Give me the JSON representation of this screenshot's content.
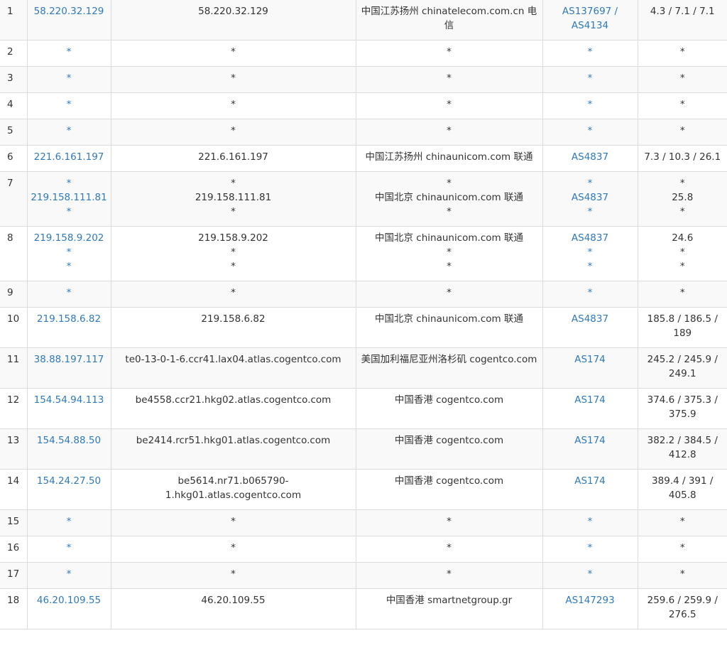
{
  "rows": [
    {
      "hop": "1",
      "ip": [
        "58.220.32.129"
      ],
      "host": [
        "58.220.32.129"
      ],
      "loc": [
        "中国江苏扬州 chinatelecom.com.cn 电信"
      ],
      "asn": [
        "AS137697 / AS4134"
      ],
      "time": [
        "4.3 / 7.1 / 7.1"
      ]
    },
    {
      "hop": "2",
      "ip": [
        "*"
      ],
      "host": [
        "*"
      ],
      "loc": [
        "*"
      ],
      "asn": [
        "*"
      ],
      "time": [
        "*"
      ]
    },
    {
      "hop": "3",
      "ip": [
        "*"
      ],
      "host": [
        "*"
      ],
      "loc": [
        "*"
      ],
      "asn": [
        "*"
      ],
      "time": [
        "*"
      ]
    },
    {
      "hop": "4",
      "ip": [
        "*"
      ],
      "host": [
        "*"
      ],
      "loc": [
        "*"
      ],
      "asn": [
        "*"
      ],
      "time": [
        "*"
      ]
    },
    {
      "hop": "5",
      "ip": [
        "*"
      ],
      "host": [
        "*"
      ],
      "loc": [
        "*"
      ],
      "asn": [
        "*"
      ],
      "time": [
        "*"
      ]
    },
    {
      "hop": "6",
      "ip": [
        "221.6.161.197"
      ],
      "host": [
        "221.6.161.197"
      ],
      "loc": [
        "中国江苏扬州 chinaunicom.com 联通"
      ],
      "asn": [
        "AS4837"
      ],
      "time": [
        "7.3 / 10.3 / 26.1"
      ]
    },
    {
      "hop": "7",
      "ip": [
        "*",
        "219.158.111.81",
        "*"
      ],
      "host": [
        "*",
        "219.158.111.81",
        "*"
      ],
      "loc": [
        "*",
        "中国北京 chinaunicom.com 联通",
        "*"
      ],
      "asn": [
        "*",
        "AS4837",
        "*"
      ],
      "time": [
        "*",
        "25.8",
        "*"
      ]
    },
    {
      "hop": "8",
      "ip": [
        "219.158.9.202",
        "*",
        "*"
      ],
      "host": [
        "219.158.9.202",
        "*",
        "*"
      ],
      "loc": [
        "中国北京 chinaunicom.com 联通",
        "*",
        "*"
      ],
      "asn": [
        "AS4837",
        "*",
        "*"
      ],
      "time": [
        "24.6",
        "*",
        "*"
      ]
    },
    {
      "hop": "9",
      "ip": [
        "*"
      ],
      "host": [
        "*"
      ],
      "loc": [
        "*"
      ],
      "asn": [
        "*"
      ],
      "time": [
        "*"
      ]
    },
    {
      "hop": "10",
      "ip": [
        "219.158.6.82"
      ],
      "host": [
        "219.158.6.82"
      ],
      "loc": [
        "中国北京 chinaunicom.com 联通"
      ],
      "asn": [
        "AS4837"
      ],
      "time": [
        "185.8 / 186.5 / 189"
      ]
    },
    {
      "hop": "11",
      "ip": [
        "38.88.197.117"
      ],
      "host": [
        "te0-13-0-1-6.ccr41.lax04.atlas.cogentco.com"
      ],
      "loc": [
        "美国加利福尼亚州洛杉矶 cogentco.com"
      ],
      "asn": [
        "AS174"
      ],
      "time": [
        "245.2 / 245.9 / 249.1"
      ]
    },
    {
      "hop": "12",
      "ip": [
        "154.54.94.113"
      ],
      "host": [
        "be4558.ccr21.hkg02.atlas.cogentco.com"
      ],
      "loc": [
        "中国香港 cogentco.com"
      ],
      "asn": [
        "AS174"
      ],
      "time": [
        "374.6 / 375.3 / 375.9"
      ]
    },
    {
      "hop": "13",
      "ip": [
        "154.54.88.50"
      ],
      "host": [
        "be2414.rcr51.hkg01.atlas.cogentco.com"
      ],
      "loc": [
        "中国香港 cogentco.com"
      ],
      "asn": [
        "AS174"
      ],
      "time": [
        "382.2 / 384.5 / 412.8"
      ]
    },
    {
      "hop": "14",
      "ip": [
        "154.24.27.50"
      ],
      "host": [
        "be5614.nr71.b065790-1.hkg01.atlas.cogentco.com"
      ],
      "loc": [
        "中国香港 cogentco.com"
      ],
      "asn": [
        "AS174"
      ],
      "time": [
        "389.4 / 391 / 405.8"
      ]
    },
    {
      "hop": "15",
      "ip": [
        "*"
      ],
      "host": [
        "*"
      ],
      "loc": [
        "*"
      ],
      "asn": [
        "*"
      ],
      "time": [
        "*"
      ]
    },
    {
      "hop": "16",
      "ip": [
        "*"
      ],
      "host": [
        "*"
      ],
      "loc": [
        "*"
      ],
      "asn": [
        "*"
      ],
      "time": [
        "*"
      ]
    },
    {
      "hop": "17",
      "ip": [
        "*"
      ],
      "host": [
        "*"
      ],
      "loc": [
        "*"
      ],
      "asn": [
        "*"
      ],
      "time": [
        "*"
      ]
    },
    {
      "hop": "18",
      "ip": [
        "46.20.109.55"
      ],
      "host": [
        "46.20.109.55"
      ],
      "loc": [
        "中国香港 smartnetgroup.gr"
      ],
      "asn": [
        "AS147293"
      ],
      "time": [
        "259.6 / 259.9 / 276.5"
      ]
    }
  ]
}
